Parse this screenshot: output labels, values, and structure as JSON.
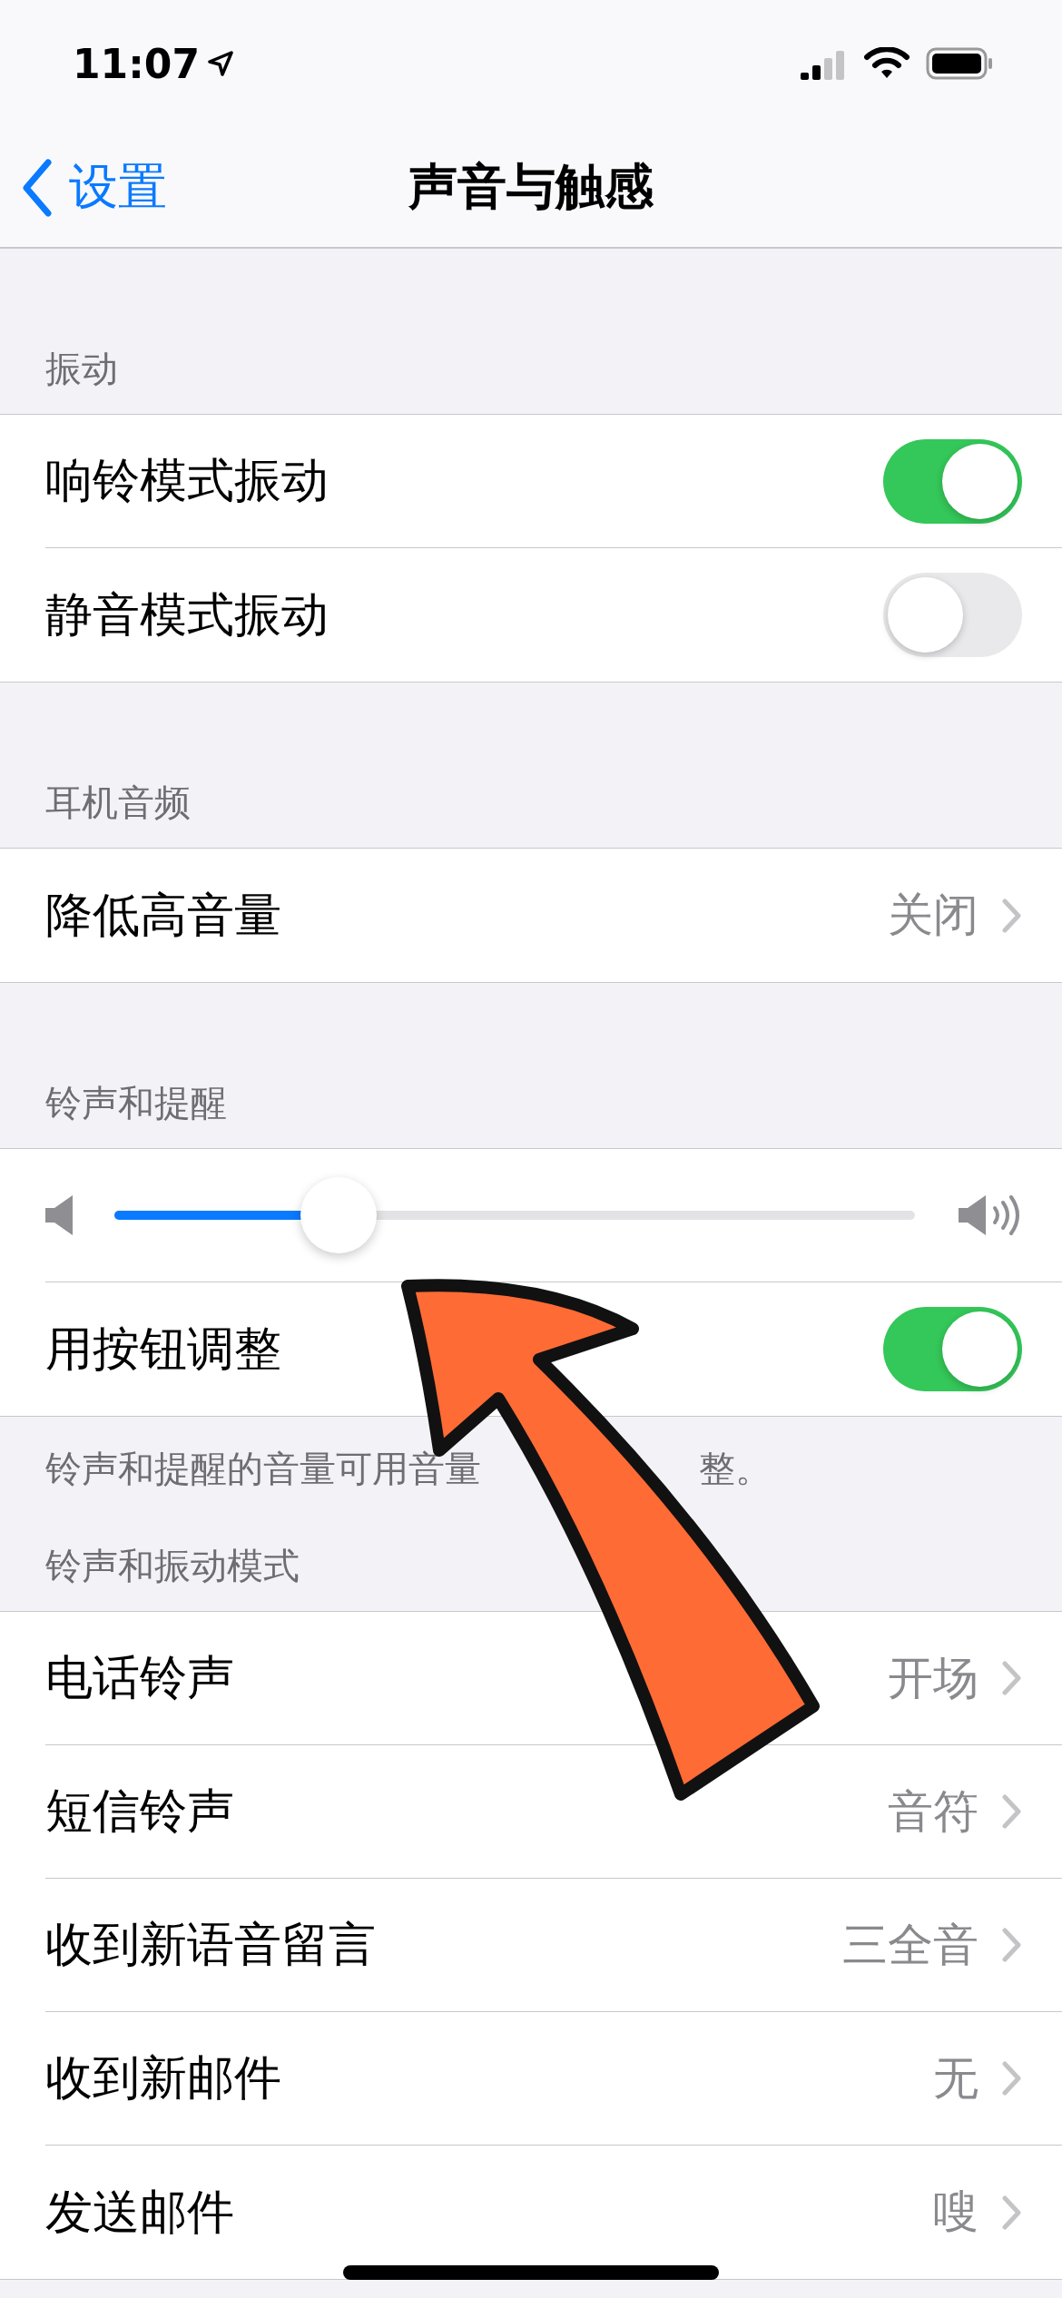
{
  "status_bar": {
    "time": "11:07"
  },
  "nav": {
    "back": "设置",
    "title": "声音与触感"
  },
  "sections": [
    {
      "header": "振动",
      "rows": [
        {
          "kind": "toggle",
          "label": "响铃模式振动",
          "on": true
        },
        {
          "kind": "toggle",
          "label": "静音模式振动",
          "on": false
        }
      ]
    },
    {
      "header": "耳机音频",
      "rows": [
        {
          "kind": "link",
          "label": "降低高音量",
          "value": "关闭"
        }
      ]
    },
    {
      "header": "铃声和提醒",
      "rows": [
        {
          "kind": "slider",
          "level": 0.28
        },
        {
          "kind": "toggle",
          "label": "用按钮调整",
          "on": true
        }
      ],
      "footer_parts": [
        "铃声和提醒的音量可用音量",
        "整。"
      ]
    },
    {
      "header": "铃声和振动模式",
      "rows": [
        {
          "kind": "link",
          "label": "电话铃声",
          "value": "开场"
        },
        {
          "kind": "link",
          "label": "短信铃声",
          "value": "音符"
        },
        {
          "kind": "link",
          "label": "收到新语音留言",
          "value": "三全音"
        },
        {
          "kind": "link",
          "label": "收到新邮件",
          "value": "无"
        },
        {
          "kind": "link",
          "label": "发送邮件",
          "value": "嗖"
        }
      ]
    }
  ]
}
